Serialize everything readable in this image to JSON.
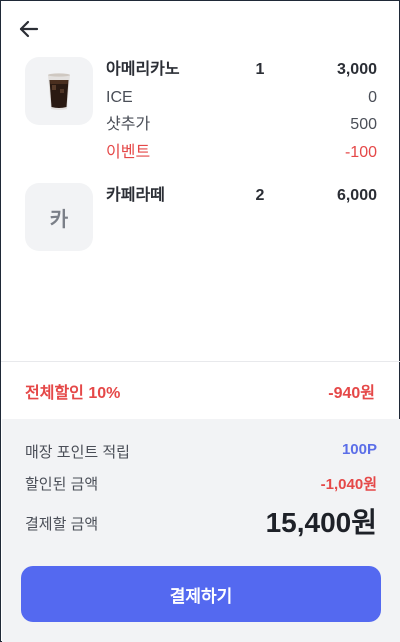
{
  "items": [
    {
      "name": "아메리카노",
      "qty": "1",
      "price": "3,000",
      "options": [
        {
          "name": "ICE",
          "price": "0",
          "type": "normal"
        },
        {
          "name": "샷추가",
          "price": "500",
          "type": "normal"
        },
        {
          "name": "이벤트",
          "price": "-100",
          "type": "event"
        }
      ]
    },
    {
      "name": "카페라떼",
      "qty": "2",
      "price": "6,000",
      "thumb_letter": "카"
    }
  ],
  "discount": {
    "label": "전체할인 10%",
    "value": "-940원"
  },
  "summary": {
    "points_label": "매장 포인트 적립",
    "points_value": "100P",
    "discounted_label": "할인된 금액",
    "discounted_value": "-1,040원",
    "total_label": "결제할 금액",
    "total_value": "15,400원"
  },
  "pay_button": "결제하기",
  "colors": {
    "accent": "#5469f0",
    "danger": "#e54848",
    "points": "#5b6ee8"
  }
}
